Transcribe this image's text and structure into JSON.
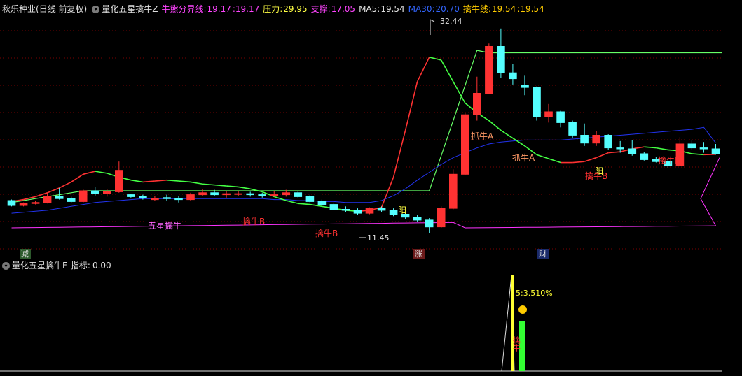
{
  "header": {
    "stock_name": "秋乐种业",
    "period": "(日线 前复权)",
    "indicator_name": "量化五星擒牛Z",
    "items": [
      {
        "label": "牛熊分界线:",
        "value": "19.17",
        "value2": ":19.17",
        "color": "#ff44ff"
      },
      {
        "label": "压力:",
        "value": "29.95",
        "color": "#ffff44"
      },
      {
        "label": "支撑:",
        "value": "17.05",
        "color": "#ff44ff"
      },
      {
        "label": "MA5:",
        "value": "19.54",
        "color": "#e0e0e0"
      },
      {
        "label": "MA30:",
        "value": "20.70",
        "color": "#3366ff"
      },
      {
        "label": "擒牛线:",
        "value": "19.54",
        "value2": ":19.54",
        "color": "#ffcc00"
      }
    ]
  },
  "main_chart": {
    "high_label": "32.44",
    "low_label": "11.45",
    "annotations": {
      "five_star": "五星擒牛",
      "qinniu_b": "擒牛B",
      "zhuaniu": "抓牛A",
      "yang": "阳",
      "jian": "减",
      "zhang": "涨",
      "cai": "财"
    }
  },
  "sub_header": {
    "indicator_name": "量化五星擒牛F",
    "label": "指标:",
    "value": "0.00"
  },
  "sub_chart": {
    "percent_label": "5:3.510%",
    "vertical_text": "擒牛"
  },
  "colors": {
    "bg": "#000000",
    "up": "#ff3232",
    "down": "#54ffff",
    "green": "#44ff44",
    "ma30": "#2233ee",
    "pink": "#ff33ff",
    "pressure": "#66ff66",
    "grid": "#7a0000"
  },
  "chart_data": {
    "type": "candlestick",
    "series": [
      {
        "name": "MA5",
        "values": [
          14.7,
          14.9,
          15.2,
          15.6,
          16.1,
          16.7,
          17.5,
          17.8,
          17.6,
          17.2,
          16.9,
          16.7,
          16.8,
          16.9,
          16.8,
          16.7,
          16.5,
          16.4,
          16.3,
          16.2,
          16.0,
          15.7,
          15.2,
          14.8,
          14.5,
          14.4,
          14.2,
          14.0,
          13.8,
          13.7,
          13.8,
          14.1,
          17.2,
          22.0,
          27.0,
          29.5,
          29.2,
          27.0,
          24.8,
          23.8,
          23.0,
          22.0,
          21.2,
          20.4,
          19.5,
          19.1,
          18.7,
          18.7,
          18.8,
          19.2,
          19.7,
          19.8,
          20.1,
          20.3,
          20.2,
          20.0,
          19.9,
          19.6,
          19.5,
          19.54
        ]
      },
      {
        "name": "MA30",
        "values": [
          13.5,
          13.6,
          13.7,
          13.8,
          14.0,
          14.2,
          14.4,
          14.6,
          14.7,
          14.8,
          14.9,
          15.0,
          15.0,
          15.0,
          15.0,
          15.0,
          15.0,
          15.0,
          15.0,
          15.0,
          15.0,
          15.0,
          14.9,
          14.9,
          14.8,
          14.8,
          14.7,
          14.7,
          14.6,
          14.6,
          14.6,
          14.8,
          15.3,
          16.0,
          16.9,
          17.7,
          18.5,
          19.2,
          19.7,
          20.2,
          20.6,
          20.8,
          20.9,
          21.0,
          21.0,
          21.0,
          21.0,
          21.1,
          21.2,
          21.3,
          21.4,
          21.5,
          21.6,
          21.7,
          21.8,
          21.9,
          22.0,
          22.1,
          22.3,
          20.7
        ]
      }
    ],
    "ohlc": [
      [
        14.8,
        14.9,
        14.2,
        14.3
      ],
      [
        14.3,
        14.6,
        14.2,
        14.5
      ],
      [
        14.5,
        14.8,
        14.4,
        14.6
      ],
      [
        14.6,
        15.6,
        14.5,
        15.2
      ],
      [
        15.2,
        16.1,
        14.9,
        15.0
      ],
      [
        15.0,
        15.2,
        14.6,
        14.7
      ],
      [
        14.7,
        16.0,
        14.6,
        15.8
      ],
      [
        15.8,
        16.2,
        15.3,
        15.5
      ],
      [
        15.5,
        16.0,
        15.2,
        15.7
      ],
      [
        15.7,
        18.8,
        15.6,
        17.9
      ],
      [
        15.4,
        15.5,
        15.1,
        15.2
      ],
      [
        15.2,
        15.4,
        14.9,
        15.1
      ],
      [
        14.9,
        15.3,
        14.8,
        15.0
      ],
      [
        15.1,
        15.4,
        14.8,
        15.0
      ],
      [
        15.0,
        15.3,
        14.6,
        14.9
      ],
      [
        14.9,
        15.6,
        14.8,
        15.4
      ],
      [
        15.4,
        16.0,
        15.3,
        15.6
      ],
      [
        15.6,
        15.9,
        15.3,
        15.4
      ],
      [
        15.4,
        15.8,
        15.1,
        15.5
      ],
      [
        15.5,
        15.8,
        15.3,
        15.5
      ],
      [
        15.5,
        15.7,
        15.2,
        15.4
      ],
      [
        15.4,
        15.6,
        15.1,
        15.3
      ],
      [
        15.3,
        15.8,
        15.2,
        15.4
      ],
      [
        15.4,
        15.9,
        15.2,
        15.6
      ],
      [
        15.6,
        15.8,
        15.1,
        15.2
      ],
      [
        15.2,
        15.4,
        14.6,
        14.7
      ],
      [
        14.7,
        14.9,
        14.2,
        14.4
      ],
      [
        14.4,
        14.6,
        13.8,
        13.9
      ],
      [
        13.9,
        14.2,
        13.6,
        13.8
      ],
      [
        13.8,
        14.0,
        13.3,
        13.5
      ],
      [
        13.5,
        14.1,
        13.4,
        14.0
      ],
      [
        14.0,
        14.2,
        13.6,
        13.8
      ],
      [
        13.8,
        14.0,
        13.2,
        13.4
      ],
      [
        13.4,
        13.6,
        12.9,
        13.1
      ],
      [
        13.1,
        13.3,
        12.6,
        12.8
      ],
      [
        12.8,
        13.0,
        11.45,
        12.1
      ],
      [
        12.1,
        14.2,
        12.0,
        14.0
      ],
      [
        14.0,
        18.0,
        13.9,
        17.5
      ],
      [
        17.5,
        23.8,
        17.4,
        23.6
      ],
      [
        23.6,
        27.5,
        23.0,
        25.8
      ],
      [
        25.8,
        30.9,
        25.7,
        30.6
      ],
      [
        30.6,
        32.44,
        27.4,
        27.9
      ],
      [
        27.9,
        28.8,
        26.7,
        27.3
      ],
      [
        26.6,
        27.6,
        25.6,
        26.4
      ],
      [
        26.4,
        26.5,
        23.0,
        23.4
      ],
      [
        23.4,
        24.7,
        22.8,
        23.9
      ],
      [
        23.9,
        24.0,
        22.3,
        22.8
      ],
      [
        22.8,
        23.0,
        21.2,
        21.5
      ],
      [
        21.5,
        22.7,
        20.4,
        20.7
      ],
      [
        20.7,
        21.9,
        20.4,
        21.5
      ],
      [
        21.5,
        21.6,
        20.0,
        20.2
      ],
      [
        20.2,
        20.9,
        19.7,
        20.1
      ],
      [
        20.1,
        21.0,
        19.4,
        19.6
      ],
      [
        19.6,
        19.8,
        18.9,
        19.0
      ],
      [
        19.0,
        19.3,
        18.7,
        18.8
      ],
      [
        18.8,
        19.0,
        18.1,
        18.4
      ],
      [
        18.4,
        21.3,
        18.3,
        20.6
      ],
      [
        20.6,
        21.0,
        20.0,
        20.2
      ],
      [
        20.2,
        20.8,
        19.7,
        20.1
      ],
      [
        20.1,
        20.6,
        19.5,
        19.6
      ]
    ],
    "high": 32.44,
    "low": 11.45,
    "ylim": [
      11.0,
      33.5
    ]
  }
}
